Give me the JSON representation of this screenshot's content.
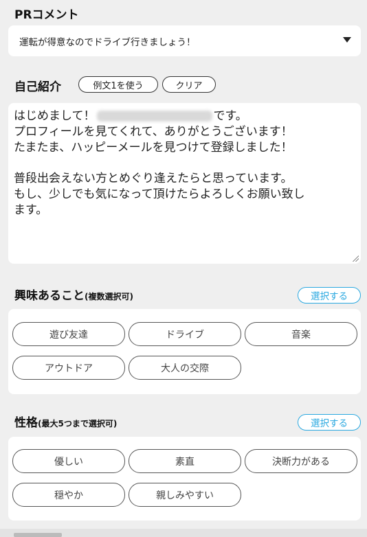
{
  "pr_comment": {
    "title": "PRコメント",
    "selected": "運転が得意なのでドライブ行きましょう！"
  },
  "self_intro": {
    "title": "自己紹介",
    "example_button": "例文1を使う",
    "clear_button": "クリア",
    "lines": [
      "はじめまして！",
      "です。",
      "プロフィールを見てくれて、ありがとうございます！",
      "たまたま、ハッピーメールを見つけて登録しました！",
      "普段出会えない方とめぐり逢えたらと思っています。",
      "もし、少しでも気になって頂けたらよろしくお願い致し",
      "ます。"
    ]
  },
  "interests": {
    "title": "興味あること",
    "subtitle": "(複数選択可)",
    "select_button": "選択する",
    "chips": [
      "遊び友達",
      "ドライブ",
      "音楽",
      "アウトドア",
      "大人の交際"
    ]
  },
  "personality": {
    "title": "性格",
    "subtitle": "(最大5つまで選択可)",
    "select_button": "選択する",
    "chips": [
      "優しい",
      "素直",
      "決断力がある",
      "穏やか",
      "親しみやすい"
    ]
  },
  "colors": {
    "accent": "#29a8e0",
    "background": "#efefef"
  }
}
